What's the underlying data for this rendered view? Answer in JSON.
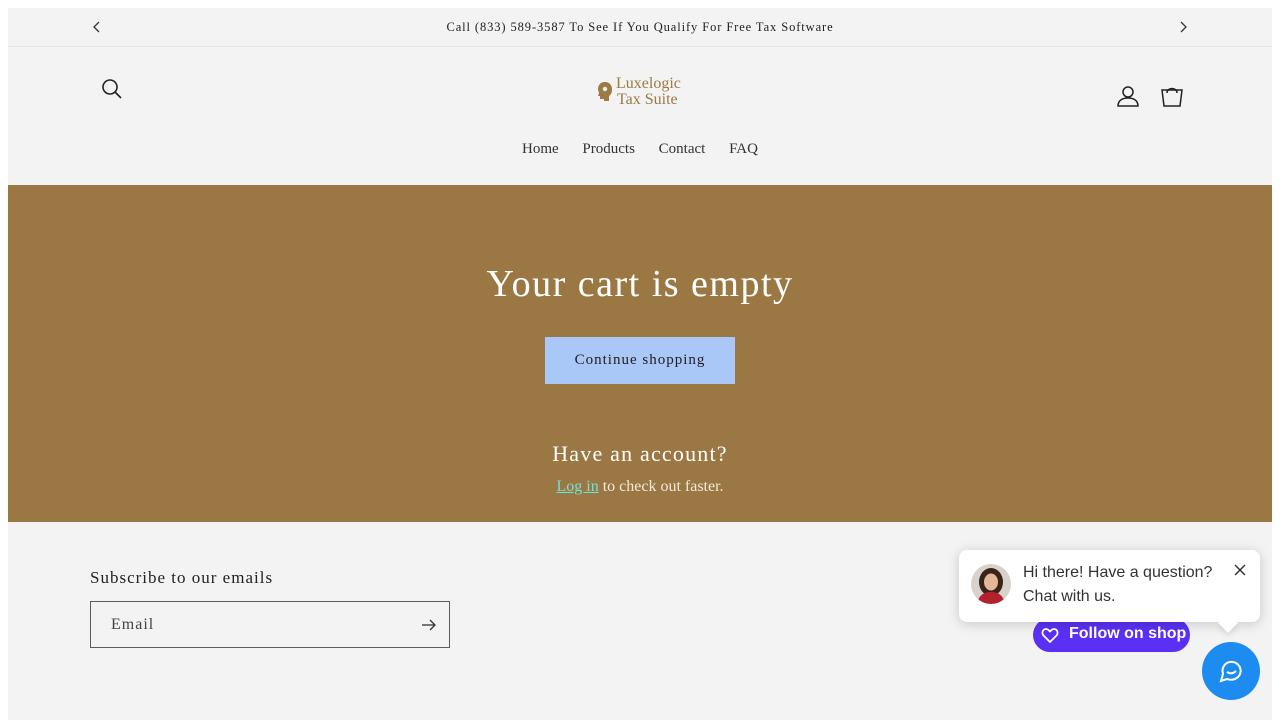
{
  "announcement": {
    "text": "Call (833) 589-3587 To See If You Qualify For Free Tax Software",
    "prev_icon": "chevron-left-icon",
    "next_icon": "chevron-right-icon"
  },
  "header": {
    "logo_line1": "Luxelogic",
    "logo_line2": "Tax Suite",
    "search_icon": "search-icon",
    "account_icon": "account-icon",
    "cart_icon": "cart-icon"
  },
  "nav": {
    "items": [
      "Home",
      "Products",
      "Contact",
      "FAQ"
    ]
  },
  "cart": {
    "title": "Your cart is empty",
    "continue_label": "Continue shopping",
    "account_heading": "Have an account?",
    "login_link": "Log in",
    "login_suffix": " to check out faster."
  },
  "footer": {
    "subscribe_heading": "Subscribe to our emails",
    "email_placeholder": "Email",
    "submit_icon": "arrow-right-icon"
  },
  "shop": {
    "follow_label": "Follow on shop"
  },
  "chat": {
    "line1": "Hi there! Have a question?",
    "line2": "Chat with us.",
    "close_icon": "close-icon",
    "launcher_icon": "chat-icon"
  },
  "colors": {
    "hero_bg": "#9b7843",
    "button_bg": "#a9c7f7",
    "login_link": "#6fe3d8",
    "brand_gold": "#9c7a43",
    "shop_purple": "#5a31f4",
    "chat_blue": "#1d8cf0"
  }
}
